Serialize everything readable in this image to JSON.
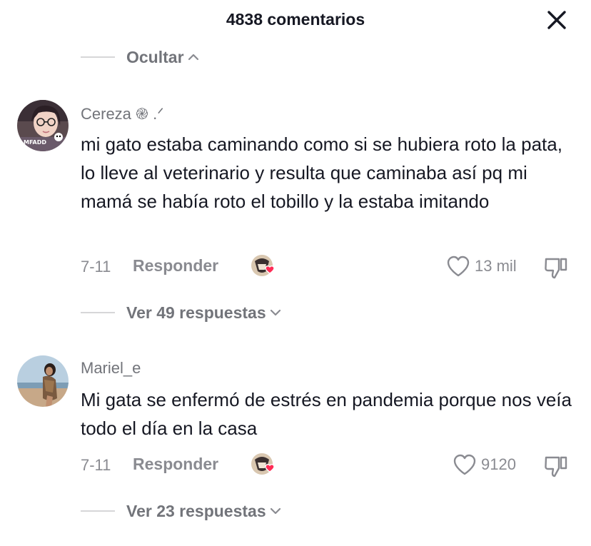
{
  "header": {
    "title": "4838 comentarios"
  },
  "collapse_toggle": {
    "label": "Ocultar"
  },
  "comments": [
    {
      "username": "Cereza ֎ .ᐟ",
      "text": "mi gato estaba caminando como si se hubiera roto la pata, lo lleve al veterinario y resulta que caminaba así pq mi mamá se había roto el tobillo y la estaba imitando",
      "date": "7-11",
      "reply_label": "Responder",
      "likes": "13 mil",
      "replies_label": "Ver 49 respuestas"
    },
    {
      "username": "Mariel_e",
      "text": "Mi gata se enfermó de estrés en pandemia porque nos veía todo el día en la casa",
      "date": "7-11",
      "reply_label": "Responder",
      "likes": "9120",
      "replies_label": "Ver 23 respuestas"
    }
  ],
  "icons": {
    "close": "close-icon",
    "collapse": "chevron-up-icon",
    "expand": "chevron-down-icon",
    "like": "heart-outline-icon",
    "dislike": "thumbs-down-icon",
    "creator_liked": "creator-liked-badge"
  },
  "colors": {
    "text_primary": "#161823",
    "text_secondary": "#8a8b91",
    "heart_badge": "#fe2c55"
  }
}
